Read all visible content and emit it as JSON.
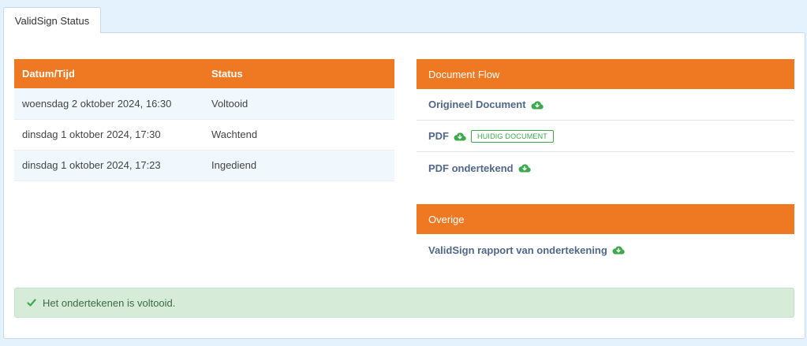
{
  "tab": {
    "label": "ValidSign Status"
  },
  "status_table": {
    "headers": [
      "Datum/Tijd",
      "Status"
    ],
    "rows": [
      {
        "datetime": "woensdag 2 oktober 2024, 16:30",
        "status": "Voltooid"
      },
      {
        "datetime": "dinsdag 1 oktober 2024, 17:30",
        "status": "Wachtend"
      },
      {
        "datetime": "dinsdag 1 oktober 2024, 17:23",
        "status": "Ingediend"
      }
    ]
  },
  "document_flow": {
    "title": "Document Flow",
    "items": [
      {
        "label": "Origineel Document",
        "icon": "cloud-download-icon"
      },
      {
        "label": "PDF",
        "icon": "cloud-download-icon",
        "badge": "HUIDIG DOCUMENT"
      },
      {
        "label": "PDF ondertekend",
        "icon": "cloud-download-icon"
      }
    ]
  },
  "overige": {
    "title": "Overige",
    "items": [
      {
        "label": "ValidSign rapport van ondertekening",
        "icon": "cloud-download-icon"
      }
    ]
  },
  "alert": {
    "icon": "check-icon",
    "message": "Het ondertekenen is voltooid."
  },
  "colors": {
    "header_orange": "#ef7822",
    "link_blue": "#4f6788",
    "success_green": "#3ea84d",
    "alert_bg": "#d6ecd9"
  }
}
